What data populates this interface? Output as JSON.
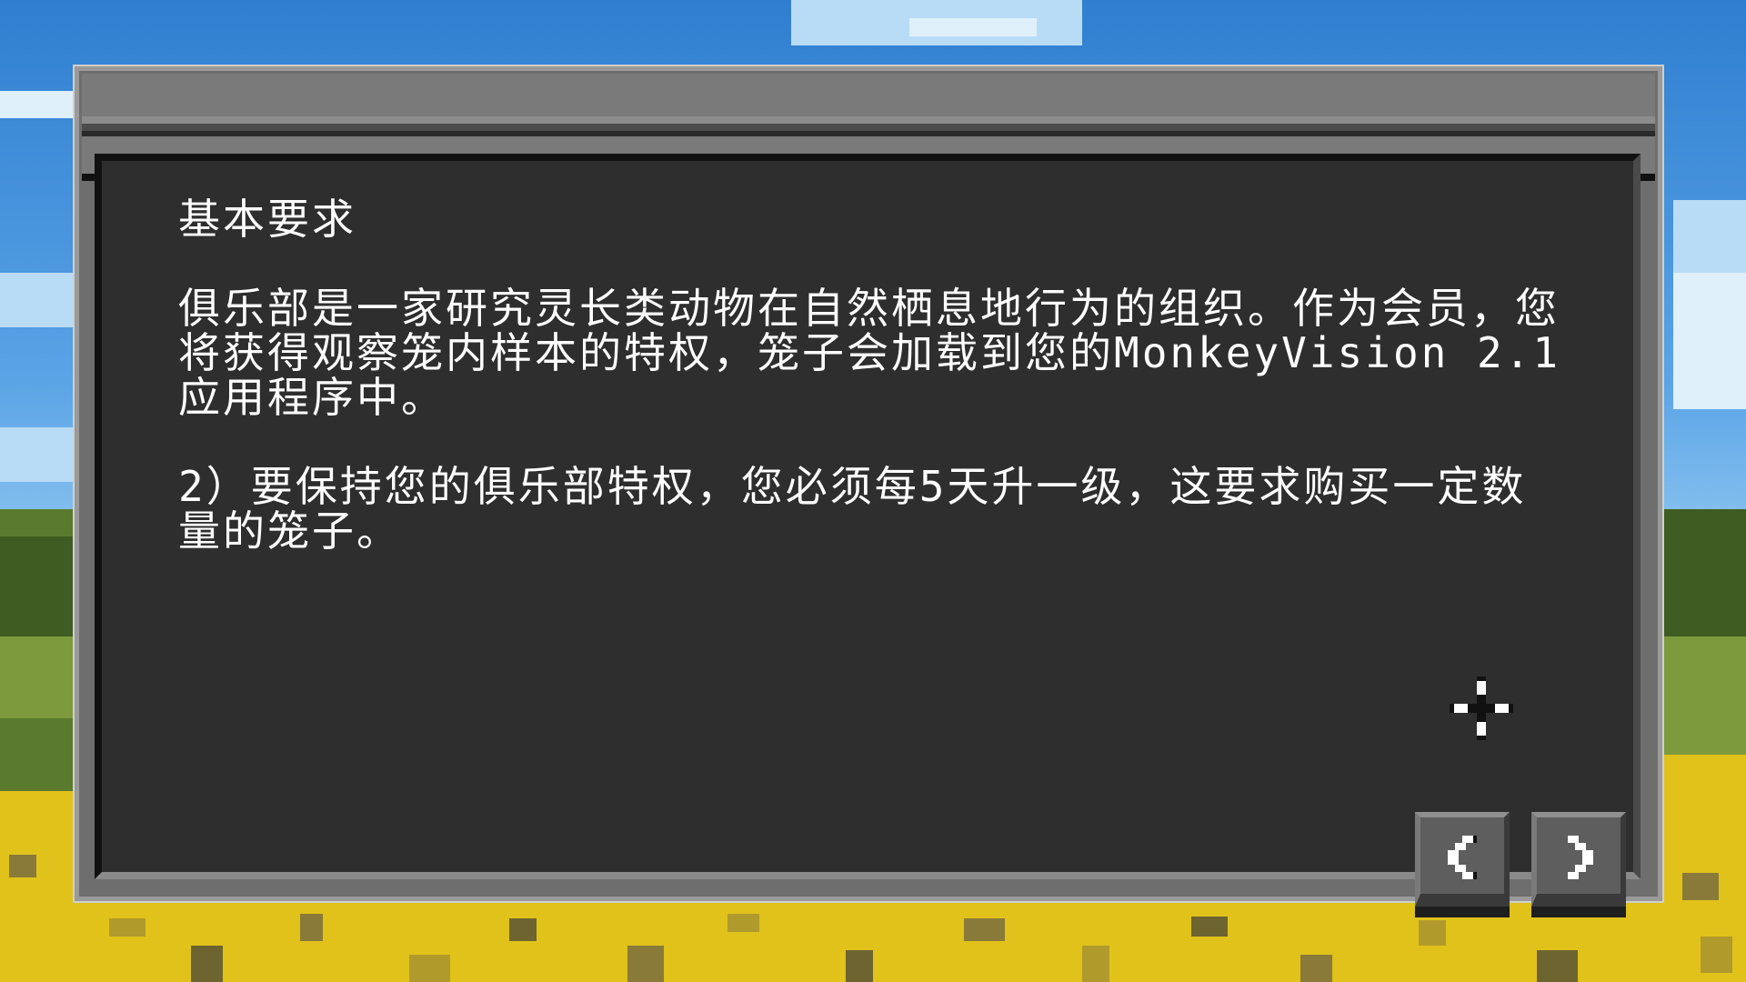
{
  "dialog": {
    "heading": "基本要求",
    "paragraphs": [
      "俱乐部是一家研究灵长类动物在自然栖息地行为的组织。作为会员，您将获得观察笼内样本的特权，笼子会加载到您的MonkeyVision 2.1应用程序中。",
      "2）要保持您的俱乐部特权，您必须每5天升一级，这要求购买一定数量的笼子。"
    ]
  },
  "nav": {
    "prev_icon": "chevron-left-icon",
    "next_icon": "chevron-right-icon"
  },
  "cursor": {
    "icon": "crosshair-cursor-icon"
  },
  "colors": {
    "panel": "#2e2e2e",
    "frame": "#6e6e6e",
    "text": "#ffffff",
    "sky": "#3b86d4",
    "field": "#e0c21a",
    "grass": "#5a7a2e"
  }
}
